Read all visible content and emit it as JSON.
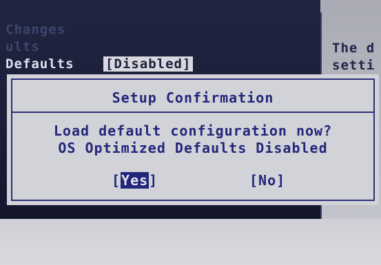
{
  "background": {
    "lines": [
      {
        "text": "Changes"
      },
      {
        "text": "ults"
      },
      {
        "text": "Defaults"
      }
    ],
    "field_value": "[Disabled]",
    "help_lines": [
      "The d",
      "setti"
    ]
  },
  "dialog": {
    "title": "Setup Confirmation",
    "message_line1": "Load default configuration now?",
    "message_line2": "OS Optimized Defaults Disabled",
    "yes": {
      "open": "[",
      "label": "Yes",
      "close": "]"
    },
    "no": {
      "label": "[No]"
    }
  }
}
